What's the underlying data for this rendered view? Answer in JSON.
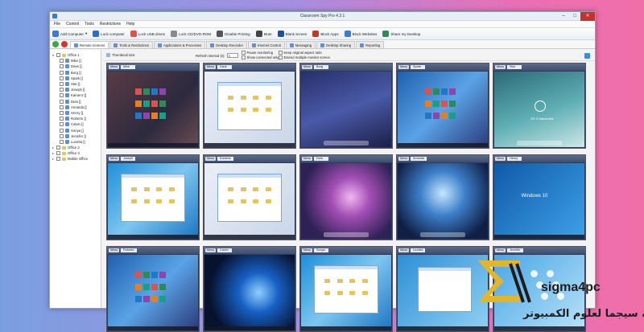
{
  "window": {
    "title": "Classroom Spy Pro 4.3.1",
    "controls": [
      "–",
      "□",
      "✕"
    ]
  },
  "menu": [
    "File",
    "Control",
    "Tools",
    "Restrictions",
    "Help"
  ],
  "toolbar": [
    {
      "label": "Add Computer",
      "icon": "add-computer-icon",
      "color": "#3b7bd4",
      "dropdown": "▾"
    },
    {
      "label": "Lock computer",
      "icon": "lock-icon",
      "color": "#2f6fc2"
    },
    {
      "label": "Lock USB drives",
      "icon": "usb-icon",
      "color": "#d9534f"
    },
    {
      "label": "Lock CD/DVD-ROM",
      "icon": "disc-icon",
      "color": "#8a8a8a"
    },
    {
      "label": "Disable Printing",
      "icon": "printer-icon",
      "color": "#555"
    },
    {
      "label": "Mute",
      "icon": "mute-icon",
      "color": "#444"
    },
    {
      "label": "Blank Screen",
      "icon": "blank-screen-icon",
      "color": "#1f4e9c"
    },
    {
      "label": "Block Apps",
      "icon": "block-apps-icon",
      "color": "#c0392b"
    },
    {
      "label": "Block Websites",
      "icon": "block-websites-icon",
      "color": "#3a7bd5"
    },
    {
      "label": "Share my Desktop",
      "icon": "share-desktop-icon",
      "color": "#2e8b57"
    }
  ],
  "tabs": [
    {
      "label": "Remote Screens",
      "active": true
    },
    {
      "label": "Tools & Restrictions"
    },
    {
      "label": "Applications & Processes"
    },
    {
      "label": "Desktop Recorder"
    },
    {
      "label": "Internet Control"
    },
    {
      "label": "Messaging"
    },
    {
      "label": "Desktop Sharing"
    },
    {
      "label": "Reporting"
    }
  ],
  "tree": {
    "root": "Office 1",
    "computers": [
      "Mike []",
      "Dave []",
      "Borg []",
      "Spark []",
      "Star []",
      "Joseph []",
      "Kamenz []",
      "Dela []",
      "Amanda []",
      "Henry []",
      "Roberto []",
      "Calvin []",
      "Sonya []",
      "Jennifer []",
      "Lucetta []"
    ],
    "other_groups": [
      "Office 2",
      "Office 3",
      "Mobile Office"
    ]
  },
  "options": {
    "thumbnail_size": "Thumbnail size:",
    "refresh_label": "Refresh interval (s):",
    "refresh_value": "3",
    "pause": "Pause monitoring",
    "show_connected": "Show connected only",
    "keep_aspect": "Keep original aspect ratio",
    "extend_monitor": "Extend multiple monitor screen"
  },
  "tiles": [
    {
      "menu": "Menu",
      "name": "Mike",
      "scene": "win8-dark"
    },
    {
      "menu": "Menu",
      "name": "Dave",
      "scene": "win7-explorer"
    },
    {
      "menu": "Menu",
      "name": "Borg",
      "scene": "mac-blue"
    },
    {
      "menu": "Menu",
      "name": "Spark",
      "scene": "win10-start"
    },
    {
      "menu": "Menu",
      "name": "Star",
      "scene": "osx-mavericks"
    },
    {
      "menu": "Menu",
      "name": "Joseph",
      "scene": "win7-explorer-blue"
    },
    {
      "menu": "Menu",
      "name": "Kamenz",
      "scene": "win7-explorer"
    },
    {
      "menu": "Menu",
      "name": "Dela",
      "scene": "mac-galaxy"
    },
    {
      "menu": "Menu",
      "name": "Amanda",
      "scene": "mac-aurora"
    },
    {
      "menu": "Menu",
      "name": "Henry",
      "scene": "win10-logo"
    },
    {
      "menu": "Menu",
      "name": "Roberto",
      "scene": "win10-start"
    },
    {
      "menu": "Menu",
      "name": "Calvin",
      "scene": "win10-hero"
    },
    {
      "menu": "Menu",
      "name": "Sonya",
      "scene": "win7-explorer-blue"
    },
    {
      "menu": "Menu",
      "name": "Lucetta",
      "scene": "win7-dialog"
    },
    {
      "menu": "Menu",
      "name": "Jennifer",
      "scene": "win8-flower"
    }
  ],
  "scene_text": {
    "osx": "OS X Mavericks",
    "win10": "Windows 10"
  },
  "watermark": {
    "brand": "sigma4pc",
    "arabic": "اكاديمية سيجما لعلوم الكمبيوتر",
    "colors": [
      "#e3b52a",
      "#1d1d1d"
    ]
  }
}
